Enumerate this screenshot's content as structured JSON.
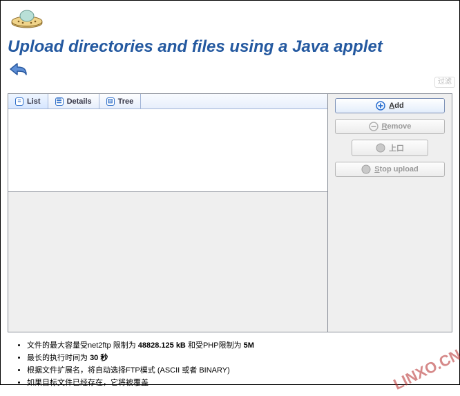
{
  "header": {
    "title": "Upload directories and files using a Java applet",
    "filter_label": "过滤"
  },
  "tabs": {
    "list": "List",
    "details": "Details",
    "tree": "Tree"
  },
  "buttons": {
    "add": "Add",
    "remove": "Remove",
    "upload": "上口",
    "stop_upload": "Stop upload"
  },
  "notes": {
    "line1_pre": "文件的最大容量受net2ftp 限制为 ",
    "line1_mid": "48828.125 kB",
    "line1_mid2": " 和受PHP限制为 ",
    "line1_end": "5M",
    "line2_pre": "最长的执行时间为 ",
    "line2_val": "30 秒",
    "line3": "根据文件扩展名，将自动选择FTP模式 (ASCII 或者 BINARY)",
    "line4": "如果目标文件已经存在，它将被覆盖"
  },
  "watermark": "LINXO.CN"
}
